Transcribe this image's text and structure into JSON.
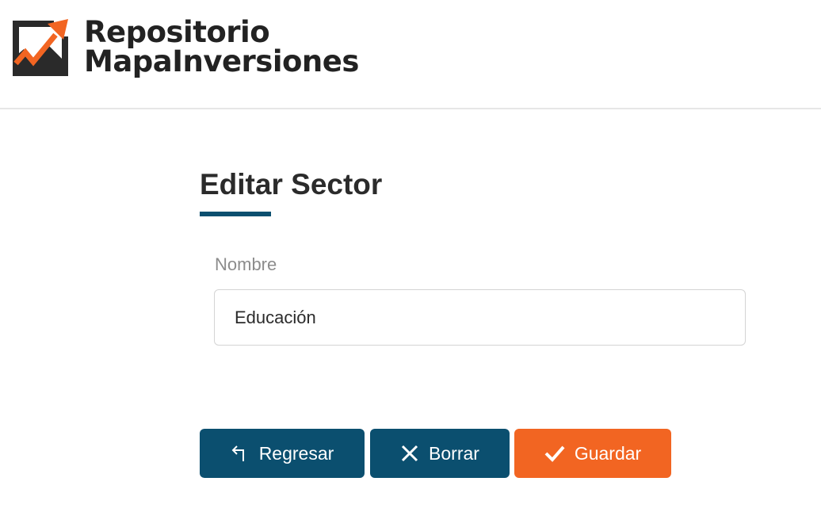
{
  "header": {
    "brand_line1": "Repositorio",
    "brand_line2": "MapaInversiones",
    "logo_icon": "chart-trend-up-icon",
    "colors": {
      "dark": "#222222",
      "accent": "#f26522"
    }
  },
  "page": {
    "title": "Editar Sector",
    "accent_color": "#0b4f6f"
  },
  "form": {
    "nombre_label": "Nombre",
    "nombre_value": "Educación"
  },
  "actions": {
    "back_label": "Regresar",
    "back_icon": "return-arrow-icon",
    "delete_label": "Borrar",
    "delete_icon": "close-icon",
    "save_label": "Guardar",
    "save_icon": "check-icon",
    "colors": {
      "primary": "#0b4f6f",
      "save": "#f26522"
    }
  }
}
